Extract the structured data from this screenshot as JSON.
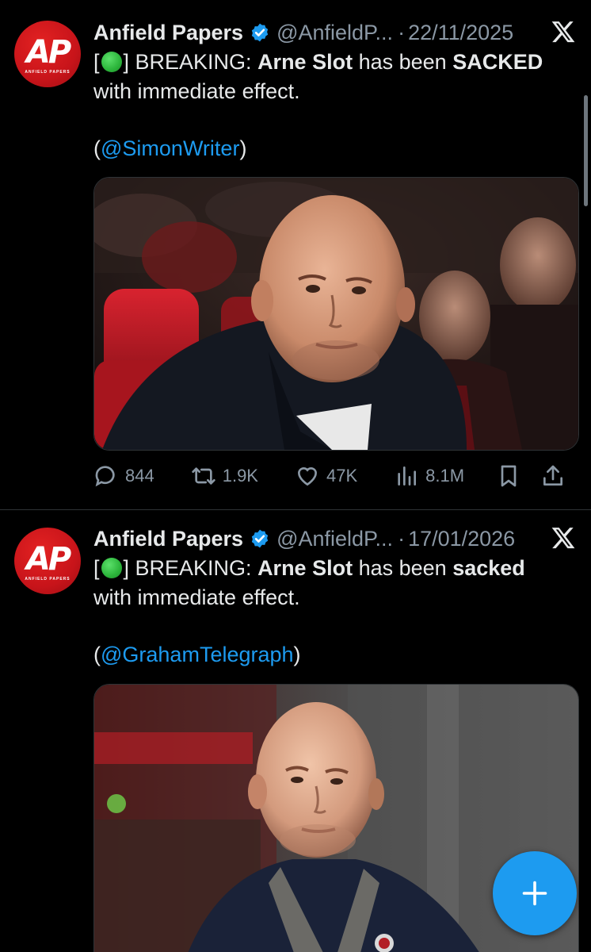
{
  "tweets": [
    {
      "author": "Anfield Papers",
      "handle": "@AnfieldP...",
      "separator": "·",
      "date": "22/11/2025",
      "text": {
        "open": "[",
        "close": "] BREAKING: ",
        "bold1": "Arne Slot",
        "mid": " has been ",
        "bold2": "SACKED",
        "line2": "with immediate effect."
      },
      "credit": {
        "open": "(",
        "mention": "@SimonWriter",
        "close": ")"
      },
      "stats": {
        "replies": "844",
        "reposts": "1.9K",
        "likes": "47K",
        "views": "8.1M"
      },
      "image_desc": "photo-arne-slot-stadium-seats"
    },
    {
      "author": "Anfield Papers",
      "handle": "@AnfieldP...",
      "separator": "·",
      "date": "17/01/2026",
      "text": {
        "open": "[",
        "close": "] BREAKING: ",
        "bold1": "Arne Slot",
        "mid": " has been ",
        "bold2": "sacked",
        "line2": "with immediate effect."
      },
      "credit": {
        "open": "(",
        "mention": "@GrahamTelegraph",
        "close": ")"
      },
      "image_desc": "photo-arne-slot-dugout"
    }
  ],
  "avatar": {
    "logo_text": "AP",
    "logo_subtext": "ANFIELD PAPERS"
  },
  "icons": [
    "verified-badge-icon",
    "x-logo-icon",
    "reply-icon",
    "repost-icon",
    "like-icon",
    "views-icon",
    "bookmark-icon",
    "share-icon",
    "compose-plus-icon"
  ],
  "colors": {
    "accent": "#1d9bf0",
    "background": "#000000",
    "muted": "#8b98a5",
    "avatar_red": "#c8141a"
  }
}
